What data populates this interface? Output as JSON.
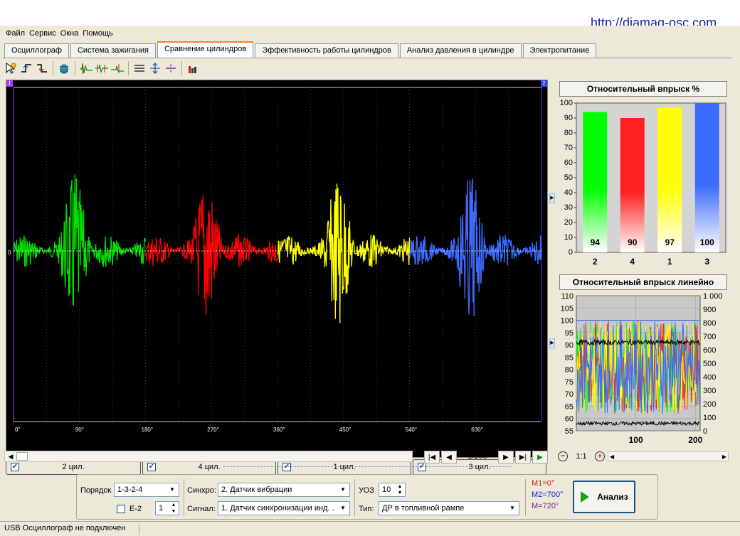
{
  "url_banner": "http://diamag-osc.com",
  "menu": [
    "Файл",
    "Сервис",
    "Окна",
    "Помощь"
  ],
  "tabs": [
    "Осциллограф",
    "Система зажигания",
    "Сравнение цилиндров",
    "Эффективность работы цилиндров",
    "Анализ давления в цилиндре",
    "Электропитание"
  ],
  "active_tab": "Сравнение цилиндров",
  "toolbar_icons": [
    "cursor-icon",
    "rising-edge-icon",
    "falling-edge-icon",
    "bug-icon",
    "wave-marker-1-icon",
    "wave-marker-2-icon",
    "wave-marker-3-icon",
    "horizontal-lines-icon",
    "vertical-zoom-icon",
    "cursor-lines-icon",
    "bar-chart-icon"
  ],
  "oscillogram": {
    "marker_left": "1",
    "marker_right": "2",
    "zero_label": "0",
    "ticks": [
      "0°",
      "90°",
      "180°",
      "270°",
      "360°",
      "450°",
      "540°",
      "630°"
    ],
    "segments": [
      {
        "color": "#00e000"
      },
      {
        "color": "#ff0000"
      },
      {
        "color": "#ffff00"
      },
      {
        "color": "#3c6cff"
      }
    ]
  },
  "channels": [
    {
      "label": "2 цил.",
      "color": "#33ee33"
    },
    {
      "label": "4 цил.",
      "color": "#ff3333"
    },
    {
      "label": "1 цил.",
      "color": "#ffff00"
    },
    {
      "label": "3 цил.",
      "color": "#4f7fff"
    }
  ],
  "nav": {
    "page": "1/208"
  },
  "zoom": {
    "ratio": "1:1"
  },
  "chart_data": [
    {
      "type": "bar",
      "title": "Относительный впрыск %",
      "categories": [
        "2",
        "4",
        "1",
        "3"
      ],
      "values": [
        94,
        90,
        97,
        100
      ],
      "colors": [
        "#00ff00",
        "#ff2020",
        "#ffff00",
        "#3a6cff"
      ],
      "ylim": [
        0,
        100
      ],
      "yticks": [
        "0",
        "10",
        "20",
        "30",
        "40",
        "50",
        "60",
        "70",
        "80",
        "90",
        "100"
      ]
    },
    {
      "type": "line",
      "title": "Относительный впрыск линейно",
      "ylim_left": [
        55,
        110
      ],
      "yticks_left": [
        "55",
        "60",
        "65",
        "70",
        "75",
        "80",
        "85",
        "90",
        "95",
        "100",
        "105",
        "110"
      ],
      "ylim_right": [
        0,
        1000
      ],
      "yticks_right": [
        "0",
        "100",
        "200",
        "300",
        "400",
        "500",
        "600",
        "700",
        "800",
        "900",
        "1 000"
      ],
      "xticks": [
        "100",
        "200"
      ],
      "xlim": [
        0,
        208
      ],
      "series": [
        {
          "color": "#00ff00"
        },
        {
          "color": "#ff2020"
        },
        {
          "color": "#ffff00"
        },
        {
          "color": "#3a6cff"
        },
        {
          "color": "#000000"
        }
      ]
    }
  ],
  "settings": {
    "order_label": "Порядок",
    "order_value": "1-3-2-4",
    "e2_label": "E-2",
    "e2_value": "1",
    "sync_label": "Синхро:",
    "sync_value": "2.  Датчик вибрации",
    "signal_label": "Сигнал:",
    "signal_value": "1.  Датчик синхронизации инд. .",
    "uoz_label": "УОЗ",
    "uoz_value": "10",
    "type_label": "Тип:",
    "type_value": "ДР в топливной рампе",
    "m1": "M1=0°",
    "m2": "M2=700°",
    "m3": "M=720°",
    "analyze_label": "Анализ"
  },
  "status": "USB Осциллограф не подключен"
}
